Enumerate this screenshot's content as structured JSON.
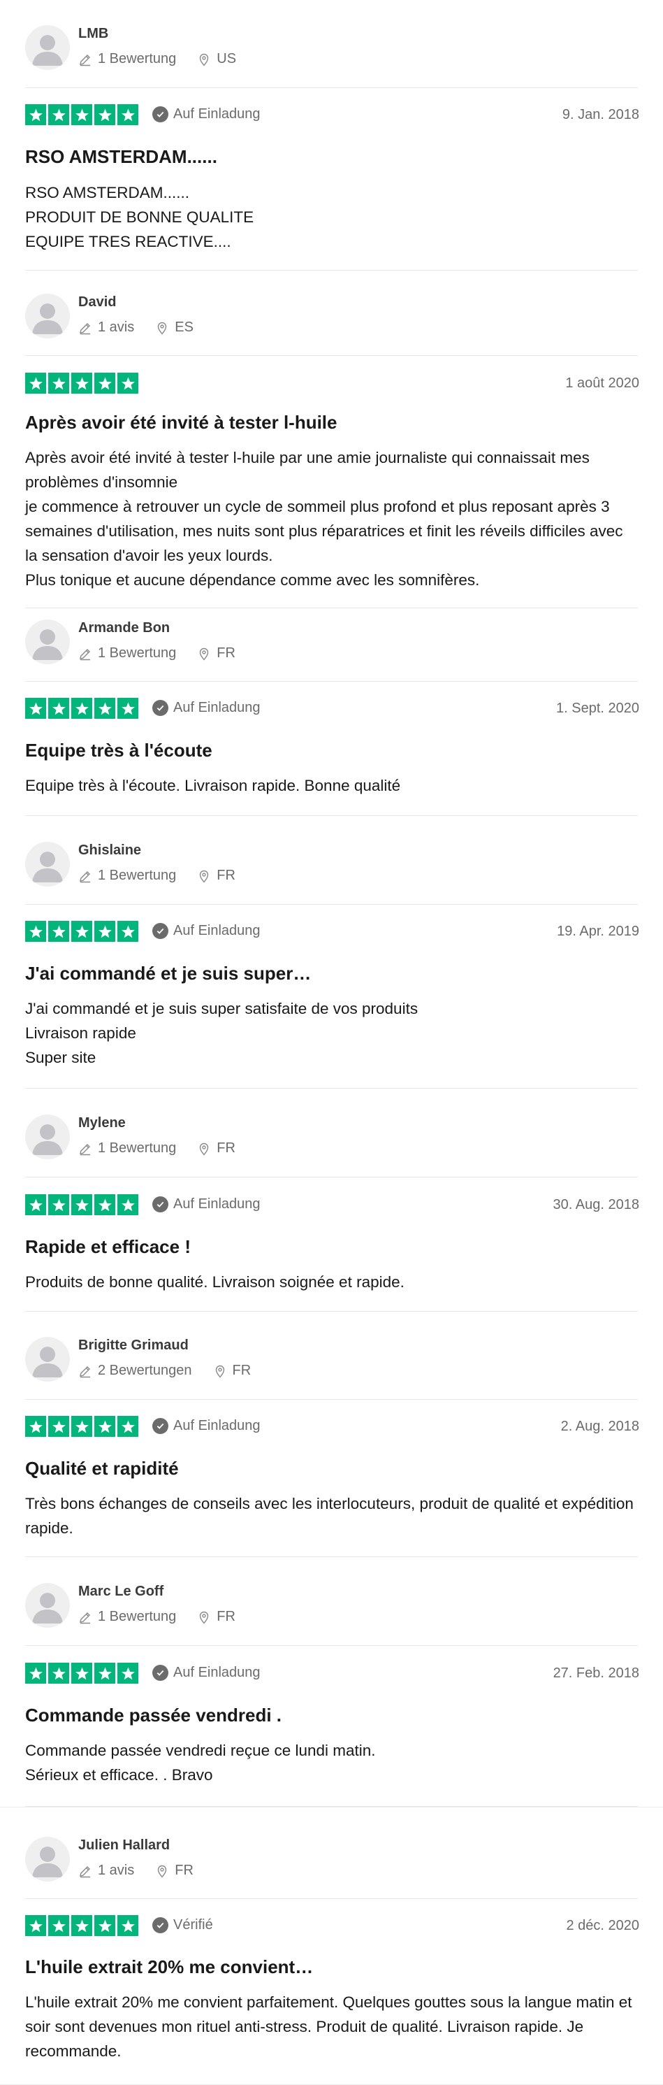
{
  "colors": {
    "star": "#00b67a",
    "muted": "#6b6b6b",
    "text": "#191919"
  },
  "icons": {
    "count": "pencil-icon",
    "location": "location-pin-icon",
    "badge": "checkmark-circle-icon",
    "star": "star-icon"
  },
  "reviews": [
    {
      "name": "LMB",
      "count": "1 Bewertung",
      "country": "US",
      "badge": "Auf Einladung",
      "date": "9. Jan. 2018",
      "rating": 5,
      "title": "RSO AMSTERDAM......",
      "body": "RSO AMSTERDAM......\nPRODUIT DE BONNE QUALITE\nEQUIPE TRES REACTIVE...."
    },
    {
      "name": "David",
      "count": "1 avis",
      "country": "ES",
      "badge": "",
      "date": "1 août 2020",
      "rating": 5,
      "title": "Après avoir été invité à tester l-huile",
      "body": "Après avoir été invité à tester l-huile par une amie journaliste qui connaissait mes problèmes d'insomnie\nje commence à retrouver un cycle de sommeil plus profond et plus reposant après 3 semaines d'utilisation, mes nuits sont plus réparatrices et finit les réveils difficiles avec la sensation d'avoir les yeux lourds.\nPlus tonique et aucune dépendance comme avec les somnifères."
    },
    {
      "name": "Armande Bon",
      "count": "1 Bewertung",
      "country": "FR",
      "badge": "Auf Einladung",
      "date": "1. Sept. 2020",
      "rating": 5,
      "title": "Equipe très à l'écoute",
      "body": "Equipe très à l'écoute. Livraison rapide. Bonne qualité"
    },
    {
      "name": "Ghislaine",
      "count": "1 Bewertung",
      "country": "FR",
      "badge": "Auf Einladung",
      "date": "19. Apr. 2019",
      "rating": 5,
      "title": "J'ai commandé et je suis super…",
      "body": "J'ai commandé et je suis super satisfaite de vos produits\nLivraison rapide\nSuper site"
    },
    {
      "name": "Mylene",
      "count": "1 Bewertung",
      "country": "FR",
      "badge": "Auf Einladung",
      "date": "30. Aug. 2018",
      "rating": 5,
      "title": "Rapide et efficace !",
      "body": "Produits de bonne qualité. Livraison soignée et rapide."
    },
    {
      "name": "Brigitte Grimaud",
      "count": "2 Bewertungen",
      "country": "FR",
      "badge": "Auf Einladung",
      "date": "2. Aug. 2018",
      "rating": 5,
      "title": "Qualité et rapidité",
      "body": "Très bons échanges de conseils avec les interlocuteurs, produit de qualité et expédition rapide."
    },
    {
      "name": "Marc Le Goff",
      "count": "1 Bewertung",
      "country": "FR",
      "badge": "Auf Einladung",
      "date": "27. Feb. 2018",
      "rating": 5,
      "title": "Commande passée vendredi .",
      "body": "Commande passée vendredi reçue ce lundi matin.\nSérieux et efficace. . Bravo"
    },
    {
      "name": "Julien Hallard",
      "count": "1 avis",
      "country": "FR",
      "badge": "Vérifié",
      "date": "2 déc. 2020",
      "rating": 5,
      "title": "L'huile extrait 20% me convient…",
      "body": "L'huile extrait 20% me convient parfaitement. Quelques gouttes sous la langue matin et soir sont devenues mon rituel anti-stress. Produit de qualité. Livraison rapide. Je recommande."
    }
  ]
}
